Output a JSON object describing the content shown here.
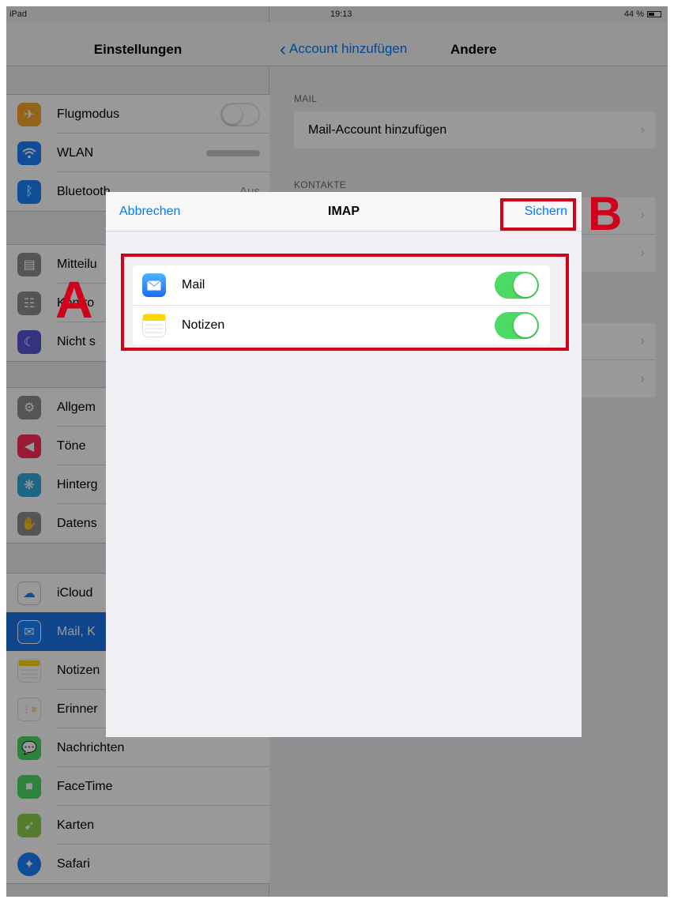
{
  "status": {
    "device": "iPad",
    "time": "19:13",
    "battery": "44 %"
  },
  "settings": {
    "title": "Einstellungen",
    "groups": [
      [
        {
          "label": "Flugmodus",
          "icon": "airplane-icon",
          "color": "#f7a530"
        },
        {
          "label": "WLAN",
          "icon": "wifi-icon",
          "color": "#1a82fb"
        },
        {
          "label": "Bluetooth",
          "icon": "bluetooth-icon",
          "color": "#1a82fb",
          "value": "Aus"
        }
      ],
      [
        {
          "label": "Mitteilu",
          "icon": "notifications-icon",
          "color": "#8e8e93"
        },
        {
          "label": "Kontro",
          "icon": "control-center-icon",
          "color": "#8e8e93"
        },
        {
          "label": "Nicht s",
          "icon": "moon-icon",
          "color": "#5856d6"
        }
      ],
      [
        {
          "label": "Allgem",
          "icon": "gear-icon",
          "color": "#8e8e93"
        },
        {
          "label": "Töne",
          "icon": "sounds-icon",
          "color": "#ff2d55"
        },
        {
          "label": "Hinterg",
          "icon": "wallpaper-icon",
          "color": "#34aadc"
        },
        {
          "label": "Datens",
          "icon": "privacy-hand-icon",
          "color": "#8e8e93"
        }
      ],
      [
        {
          "label": "iCloud",
          "icon": "icloud-icon",
          "color": "#ffffff"
        },
        {
          "label": "Mail, K",
          "icon": "mail-icon",
          "color": "#1a82fb",
          "selected": true
        },
        {
          "label": "Notizen",
          "icon": "notes-icon",
          "color": "#ffd60a"
        },
        {
          "label": "Erinner",
          "icon": "reminders-icon",
          "color": "#ffffff"
        },
        {
          "label": "Nachrichten",
          "icon": "messages-icon",
          "color": "#4cd964"
        },
        {
          "label": "FaceTime",
          "icon": "facetime-icon",
          "color": "#4cd964"
        },
        {
          "label": "Karten",
          "icon": "maps-icon",
          "color": "#8fd14f"
        },
        {
          "label": "Safari",
          "icon": "safari-icon",
          "color": "#1a82fb"
        }
      ]
    ]
  },
  "detail": {
    "back_label": "Account hinzufügen",
    "title": "Andere",
    "mail_section": "MAIL",
    "mail_row": "Mail-Account hinzufügen",
    "contacts_section": "KONTAKTE"
  },
  "modal": {
    "cancel": "Abbrechen",
    "title": "IMAP",
    "save": "Sichern",
    "toggles": [
      {
        "label": "Mail",
        "on": true
      },
      {
        "label": "Notizen",
        "on": true
      }
    ]
  },
  "annotations": {
    "a": "A",
    "b": "B",
    "color": "#d0021b"
  }
}
